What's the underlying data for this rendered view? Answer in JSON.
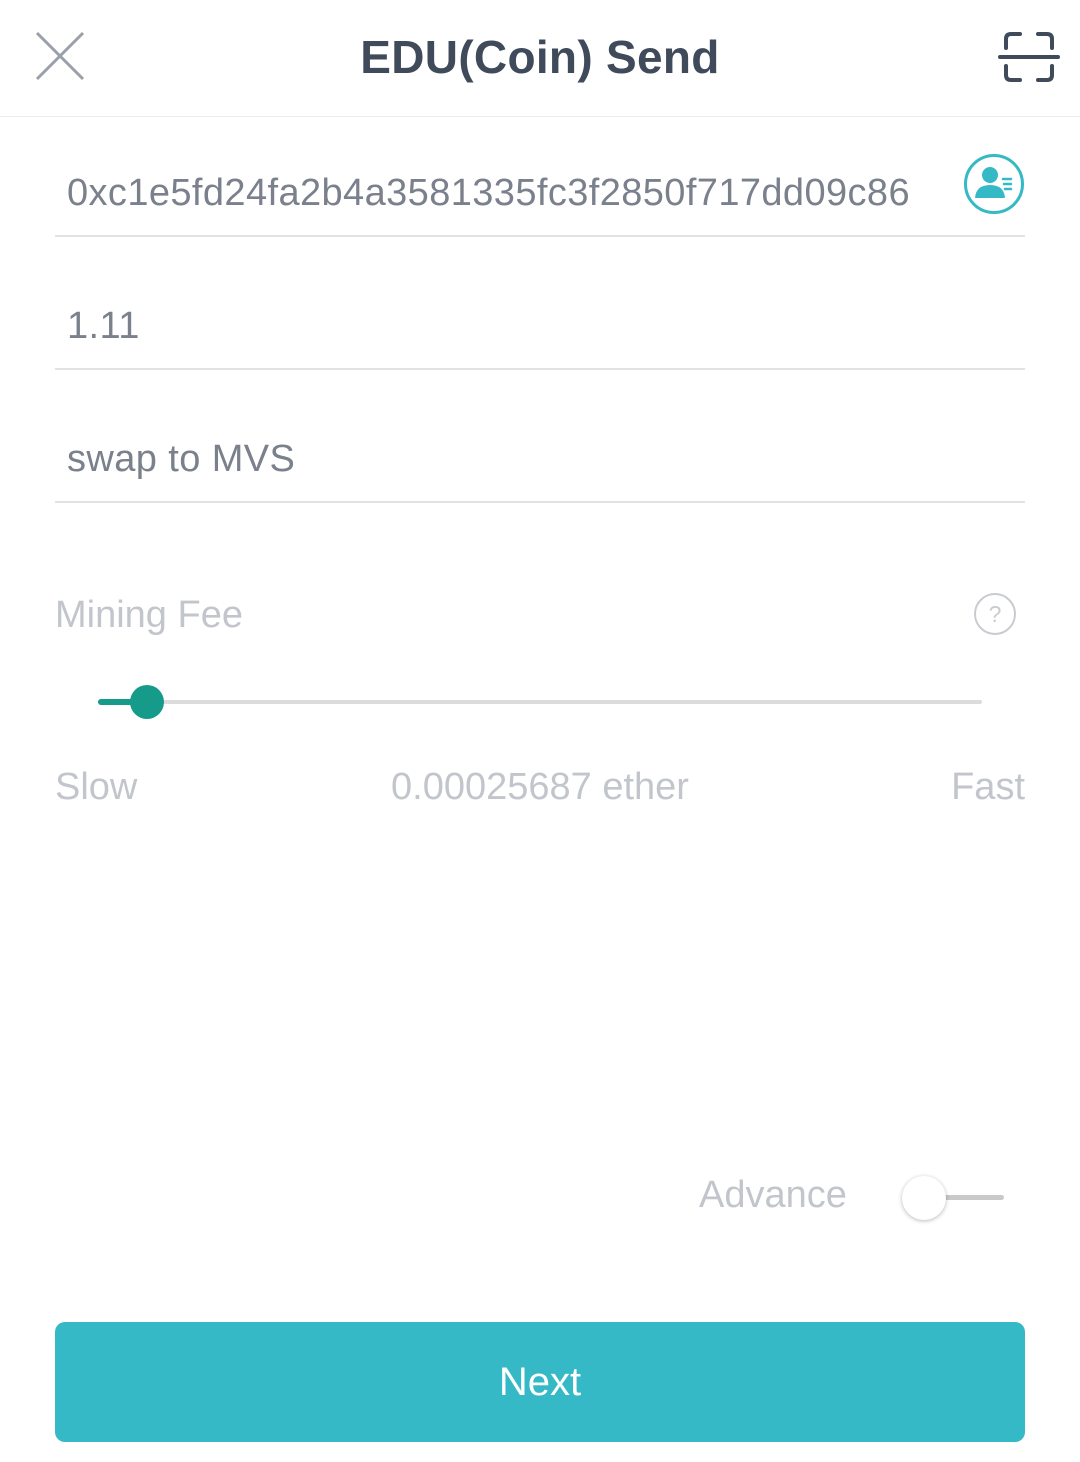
{
  "header": {
    "title": "EDU(Coin) Send",
    "close_icon": "close-icon",
    "scan_icon": "scan-qr-icon"
  },
  "form": {
    "address": "0xc1e5fd24fa2b4a3581335fc3f2850f717dd09c86",
    "amount": "1.11",
    "memo": "swap to MVS",
    "contacts_icon": "contacts-icon"
  },
  "mining_fee": {
    "label": "Mining Fee",
    "help_icon": "help-icon",
    "slow_label": "Slow",
    "fast_label": "Fast",
    "amount": "0.00025687 ether",
    "slider_level": 0.055
  },
  "advance": {
    "label": "Advance",
    "enabled": false
  },
  "next_button": {
    "label": "Next"
  },
  "colors": {
    "accent": "#36b9c6",
    "slider": "#169a8a",
    "title": "#3f4a5a",
    "muted": "#c2c6cc"
  }
}
